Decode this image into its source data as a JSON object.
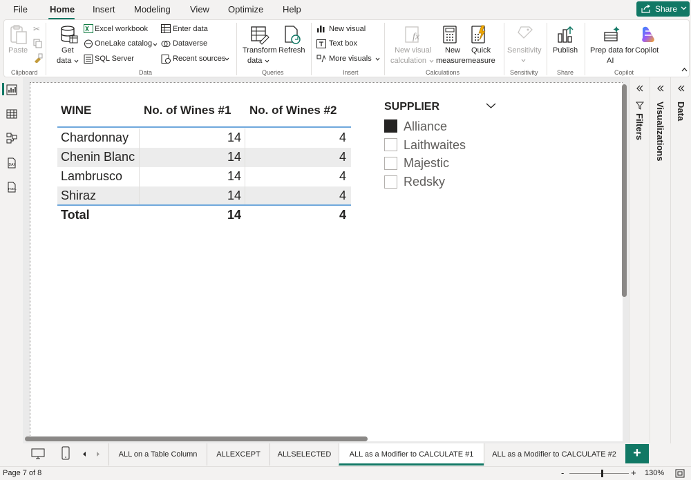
{
  "menu": {
    "items": [
      "File",
      "Home",
      "Insert",
      "Modeling",
      "View",
      "Optimize",
      "Help"
    ],
    "active": "Home",
    "share_label": "Share"
  },
  "ribbon": {
    "clipboard": {
      "paste": "Paste",
      "group": "Clipboard"
    },
    "data": {
      "get_data_1": "Get",
      "get_data_2": "data",
      "excel": "Excel workbook",
      "onelake": "OneLake catalog",
      "sql": "SQL Server",
      "enter_data": "Enter data",
      "dataverse": "Dataverse",
      "recent": "Recent sources",
      "group": "Data"
    },
    "queries": {
      "transform_1": "Transform",
      "transform_2": "data",
      "refresh": "Refresh",
      "group": "Queries"
    },
    "insert": {
      "new_visual": "New visual",
      "text_box": "Text box",
      "more_visuals": "More visuals",
      "group": "Insert"
    },
    "calculations": {
      "new_visual_calc_1": "New visual",
      "new_visual_calc_2": "calculation",
      "new_measure_1": "New",
      "new_measure_2": "measure",
      "quick_measure_1": "Quick",
      "quick_measure_2": "measure",
      "group": "Calculations"
    },
    "sensitivity": {
      "label": "Sensitivity",
      "group": "Sensitivity"
    },
    "share": {
      "publish": "Publish",
      "group": "Share"
    },
    "copilot": {
      "prep_1": "Prep data for",
      "prep_2": "AI",
      "copilot": "Copilot",
      "group": "Copilot"
    }
  },
  "table": {
    "headers": [
      "WINE",
      "No. of Wines #1",
      "No. of Wines #2"
    ],
    "rows": [
      {
        "wine": "Chardonnay",
        "n1": "14",
        "n2": "4"
      },
      {
        "wine": "Chenin Blanc",
        "n1": "14",
        "n2": "4"
      },
      {
        "wine": "Lambrusco",
        "n1": "14",
        "n2": "4"
      },
      {
        "wine": "Shiraz",
        "n1": "14",
        "n2": "4"
      }
    ],
    "total": {
      "wine": "Total",
      "n1": "14",
      "n2": "4"
    }
  },
  "slicer": {
    "title": "SUPPLIER",
    "items": [
      {
        "label": "Alliance",
        "checked": true
      },
      {
        "label": "Laithwaites",
        "checked": false
      },
      {
        "label": "Majestic",
        "checked": false
      },
      {
        "label": "Redsky",
        "checked": false
      }
    ]
  },
  "panes": {
    "filters": "Filters",
    "visualizations": "Visualizations",
    "data": "Data"
  },
  "page_tabs": [
    "ALL on a Table Column",
    "ALLEXCEPT",
    "ALLSELECTED",
    "ALL as a Modifier to CALCULATE #1",
    "ALL as a Modifier to CALCULATE #2"
  ],
  "active_tab": "ALL as a Modifier to CALCULATE #1",
  "status": {
    "page": "Page 7 of 8",
    "zoom": "130%",
    "zoom_level": 0.55
  },
  "colors": {
    "accent": "#117865",
    "table_line": "#6fa8dc",
    "row_alt": "#ececec"
  }
}
